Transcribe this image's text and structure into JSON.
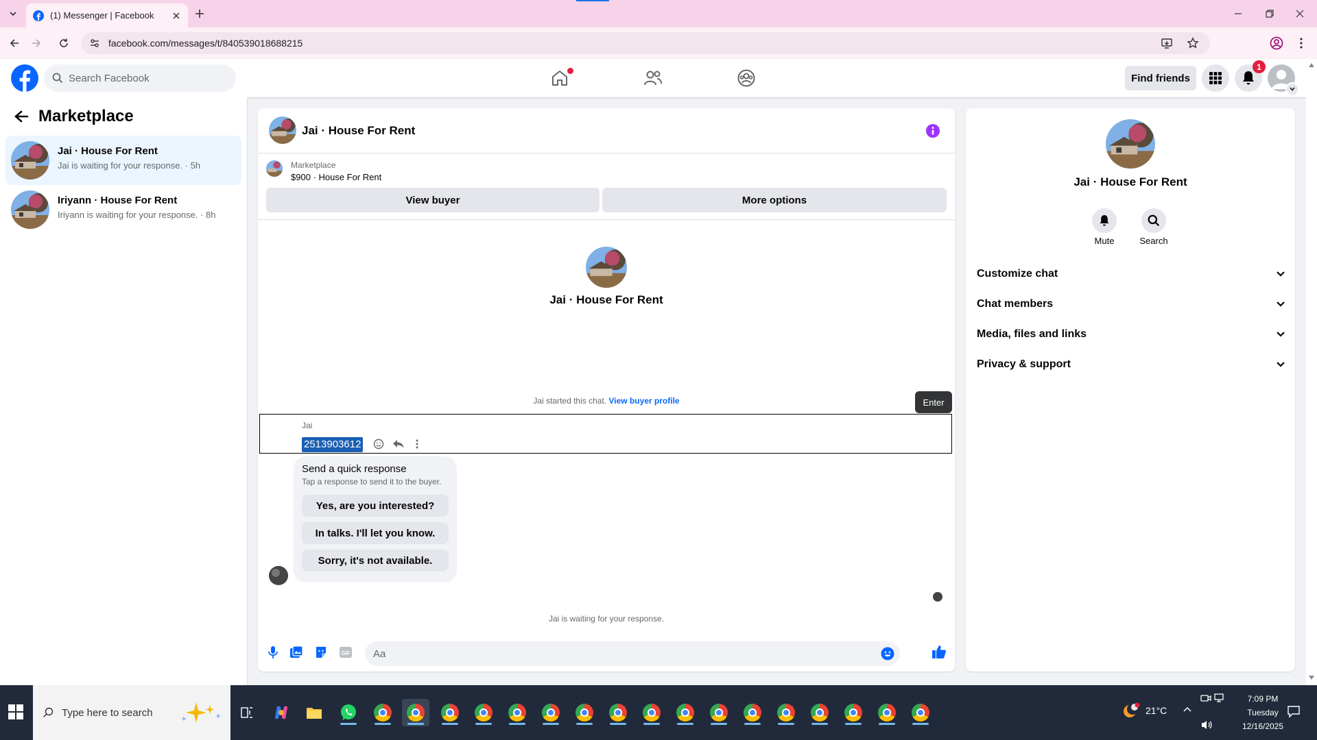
{
  "browser": {
    "tab_title": "(1) Messenger | Facebook",
    "url": "facebook.com/messages/t/840539018688215"
  },
  "header": {
    "search_placeholder": "Search Facebook",
    "find_friends": "Find friends",
    "notif_count": "1"
  },
  "sidebar": {
    "title": "Marketplace",
    "conversations": [
      {
        "name": "Jai · House For Rent",
        "preview": "Jai is waiting for your response. · 5h"
      },
      {
        "name": "Iriyann · House For Rent",
        "preview": "Iriyann is waiting for your response. · 8h"
      }
    ]
  },
  "chat": {
    "title": "Jai · House For Rent",
    "listing_label": "Marketplace",
    "listing_price": "$900 · House For Rent",
    "view_buyer": "View buyer",
    "more_options": "More options",
    "center_name": "Jai · House For Rent",
    "started_text": "Jai started this chat.",
    "view_buyer_profile": "View buyer profile",
    "enter_tooltip": "Enter",
    "sender": "Jai",
    "message": "2513903612",
    "quick_title": "Send a quick response",
    "quick_sub": "Tap a response to send it to the buyer.",
    "quick_responses": [
      "Yes, are you interested?",
      "In talks. I'll let you know.",
      "Sorry, it's not available."
    ],
    "waiting_text": "Jai is waiting for your response.",
    "composer_placeholder": "Aa"
  },
  "info": {
    "name": "Jai · House For Rent",
    "mute": "Mute",
    "search": "Search",
    "sections": [
      "Customize chat",
      "Chat members",
      "Media, files and links",
      "Privacy & support"
    ]
  },
  "taskbar": {
    "search_placeholder": "Type here to search",
    "weather": "21°C",
    "time": "7:09 PM",
    "day": "Tuesday",
    "date": "12/16/2025"
  },
  "colors": {
    "fb_blue": "#0866ff",
    "messenger_purple": "#a033ff",
    "tab_pink": "#f7d3ea"
  }
}
